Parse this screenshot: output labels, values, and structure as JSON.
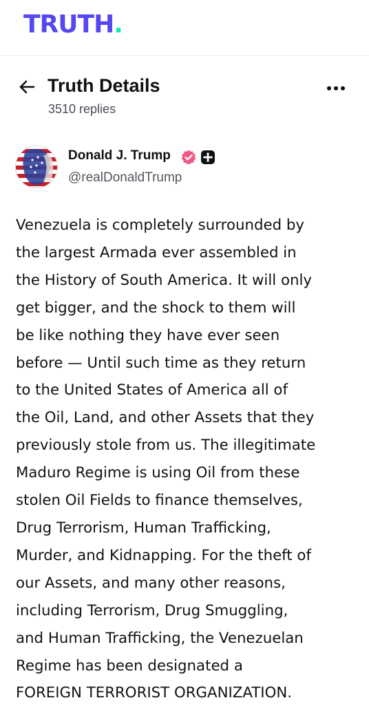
{
  "app": {
    "logo_text": "TRUTH",
    "logo_dot": ".",
    "brand_color": "#5448ee",
    "accent_color": "#17e3b4"
  },
  "header": {
    "back_icon": "arrow-left-icon",
    "title": "Truth Details",
    "replies": "3510 replies",
    "more_icon": "more-horizontal-icon"
  },
  "author": {
    "name": "Donald J. Trump",
    "handle": "@realDonaldTrump",
    "verified_icon": "verified-badge-icon",
    "verified_color": "#ee5a86",
    "extra_badge_icon": "plus-square-icon"
  },
  "post": {
    "lines": [
      "Venezuela is completely surrounded by",
      "the largest Armada ever assembled in",
      "the History of South America. It will only",
      "get bigger, and the shock to them will",
      "be like nothing they have ever seen",
      "before — Until such time as they return",
      "to the United States of America all of",
      "the Oil, Land, and other Assets that they",
      "previously stole from us. The illegitimate",
      "Maduro Regime is using Oil from these",
      "stolen Oil Fields to finance themselves,",
      "Drug Terrorism, Human Trafficking,",
      "Murder, and Kidnapping. For the theft of",
      "our Assets, and many other reasons,",
      "including Terrorism, Drug Smuggling,",
      "and Human Trafficking, the Venezuelan",
      "Regime has been designated a",
      "FOREIGN TERRORIST ORGANIZATION."
    ]
  }
}
